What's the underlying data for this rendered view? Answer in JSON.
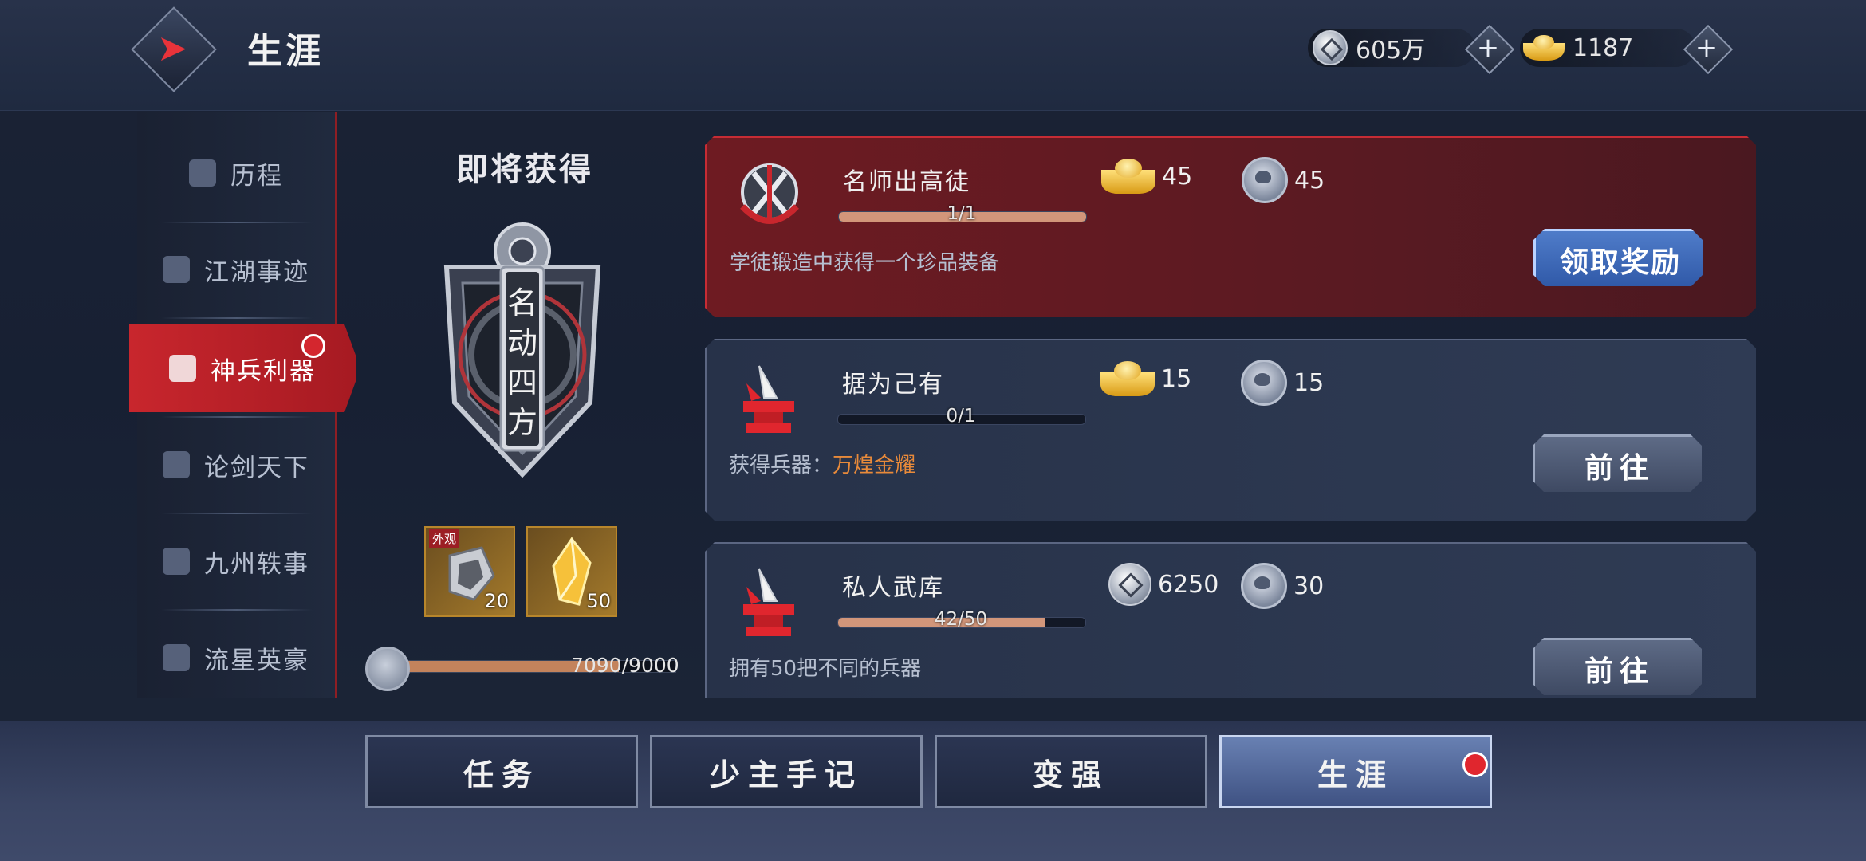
{
  "header": {
    "title": "生涯",
    "silver": "605万",
    "gold": "1187"
  },
  "sidebar": {
    "items": [
      {
        "label": "历程",
        "icon": "helmet-icon"
      },
      {
        "label": "江湖事迹",
        "icon": "book-icon"
      },
      {
        "label": "神兵利器",
        "icon": "crossed-swords-icon",
        "active": true
      },
      {
        "label": "论剑天下",
        "icon": "sword-burst-icon"
      },
      {
        "label": "九州轶事",
        "icon": "mountain-icon"
      },
      {
        "label": "流星英豪",
        "icon": "hero-helmet-icon"
      }
    ]
  },
  "upcoming": {
    "title": "即将获得",
    "badge_text": [
      "名",
      "动",
      "四",
      "方"
    ],
    "rewards": [
      {
        "tag": "外观",
        "count": "20",
        "icon": "outfit-fragment-icon"
      },
      {
        "tag": "",
        "count": "50",
        "icon": "crystal-icon"
      }
    ],
    "progress_text": "7090/9000",
    "progress": 0.788
  },
  "tasks": [
    {
      "name": "名师出高徒",
      "reward1_icon": "gold-ingot-icon",
      "reward1_value": "45",
      "reward2_icon": "lotus-token-icon",
      "reward2_value": "45",
      "progress_text": "1/1",
      "progress": 1.0,
      "desc": "学徒锻造中获得一个珍品装备",
      "desc_highlight": "",
      "button": "领取奖励",
      "highlight": true
    },
    {
      "name": "据为己有",
      "reward1_icon": "gold-ingot-icon",
      "reward1_value": "15",
      "reward2_icon": "lotus-token-icon",
      "reward2_value": "15",
      "progress_text": "0/1",
      "progress": 0.0,
      "desc": "获得兵器：",
      "desc_highlight": "万煌金耀",
      "button": "前往",
      "highlight": false
    },
    {
      "name": "私人武库",
      "reward1_icon": "silver-coin-icon",
      "reward1_value": "6250",
      "reward2_icon": "lotus-token-icon",
      "reward2_value": "30",
      "progress_text": "42/50",
      "progress": 0.84,
      "desc": "拥有50把不同的兵器",
      "desc_highlight": "",
      "button": "前往",
      "highlight": false
    }
  ],
  "bottom_nav": {
    "items": [
      "任务",
      "少主手记",
      "变强",
      "生涯"
    ],
    "active": "生涯"
  },
  "colors": {
    "accent_red": "#c8262d",
    "claim_blue": "#3f67b8",
    "highlight_orange": "#e88a3a"
  }
}
